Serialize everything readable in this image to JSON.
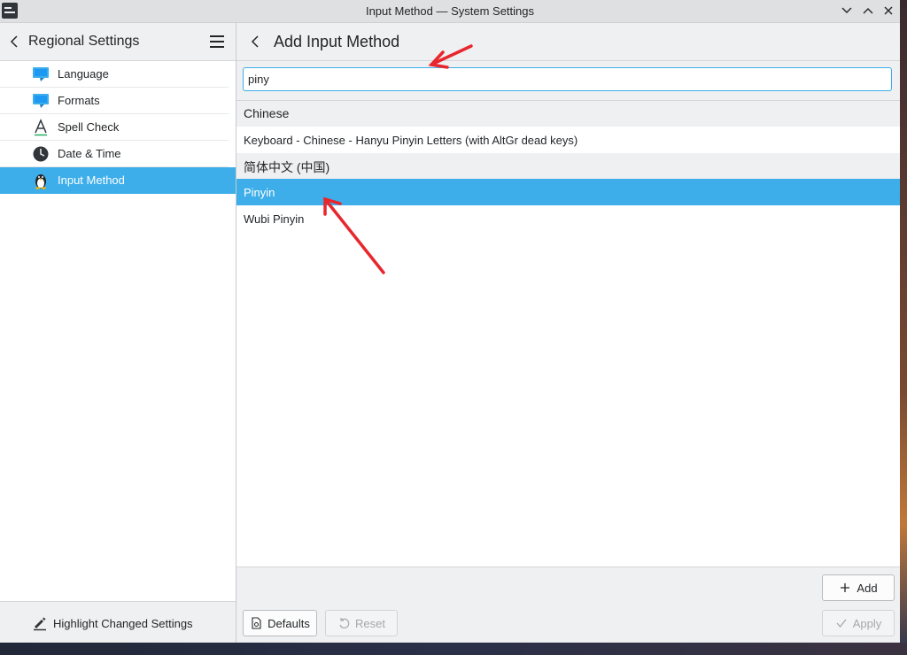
{
  "window": {
    "title": "Input Method — System Settings"
  },
  "sidebar": {
    "title": "Regional Settings",
    "items": [
      {
        "label": "Language",
        "icon": "language-icon"
      },
      {
        "label": "Formats",
        "icon": "formats-icon"
      },
      {
        "label": "Spell Check",
        "icon": "spellcheck-icon"
      },
      {
        "label": "Date & Time",
        "icon": "clock-icon"
      },
      {
        "label": "Input Method",
        "icon": "penguin-icon",
        "selected": true
      }
    ],
    "footer_label": "Highlight Changed Settings"
  },
  "main": {
    "title": "Add Input Method",
    "search": {
      "value": "piny",
      "placeholder": ""
    },
    "list": [
      {
        "type": "section",
        "label": "Chinese"
      },
      {
        "type": "item",
        "label": "Keyboard - Chinese - Hanyu Pinyin Letters (with AltGr dead keys)"
      },
      {
        "type": "section",
        "label": "简体中文 (中国)"
      },
      {
        "type": "item",
        "label": "Pinyin",
        "selected": true
      },
      {
        "type": "item",
        "label": "Wubi Pinyin"
      }
    ],
    "buttons": {
      "add": "Add",
      "defaults": "Defaults",
      "reset": "Reset",
      "apply": "Apply"
    }
  },
  "colors": {
    "accent": "#3daee9",
    "annotation": "#e8262d"
  }
}
